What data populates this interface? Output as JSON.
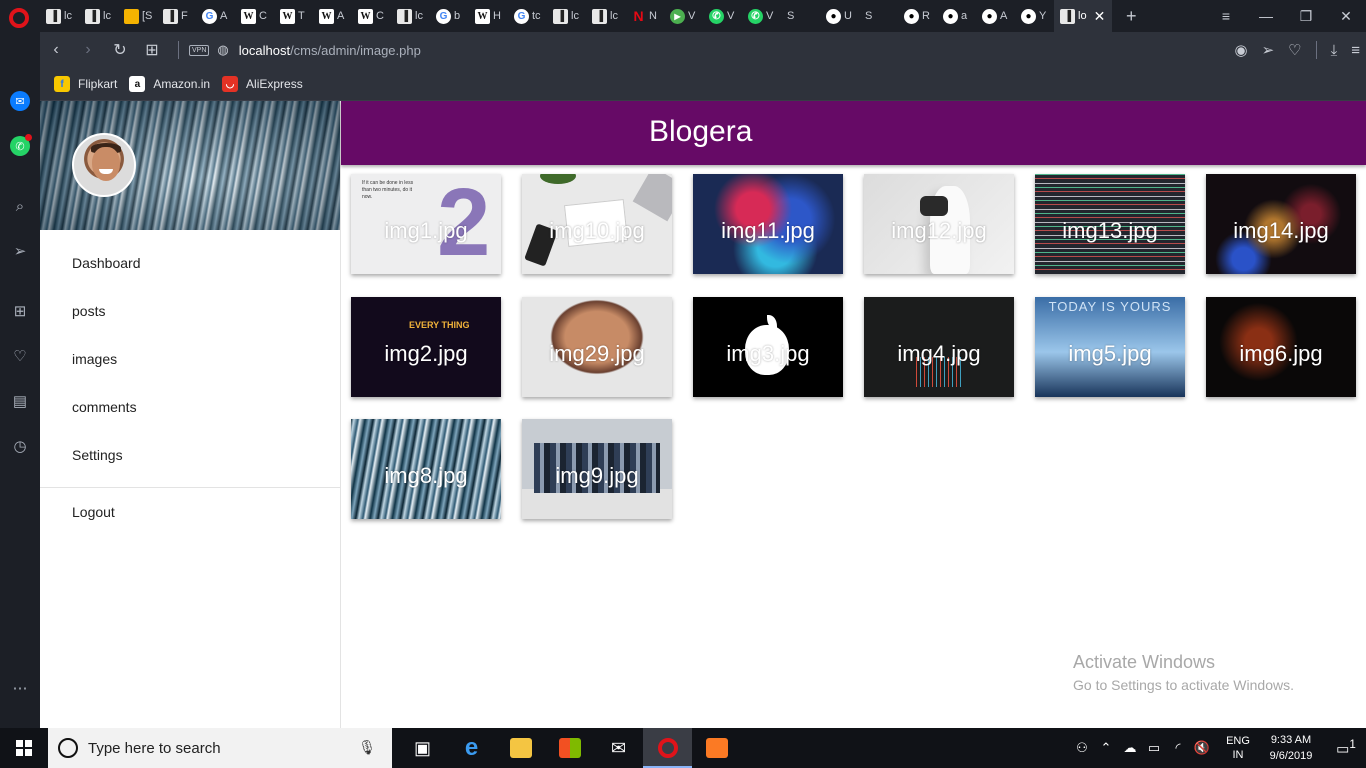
{
  "browser": {
    "tabs": [
      {
        "icon": "page-icon",
        "label": "lc",
        "icon_char": "▐",
        "kind": ""
      },
      {
        "icon": "page-icon",
        "label": "lc",
        "icon_char": "▐",
        "kind": ""
      },
      {
        "icon": "picture-icon",
        "label": "[S",
        "icon_char": "",
        "kind": "pic"
      },
      {
        "icon": "page-icon",
        "label": "F",
        "icon_char": "▐",
        "kind": ""
      },
      {
        "icon": "google-icon",
        "label": "A",
        "icon_char": "G",
        "kind": "g"
      },
      {
        "icon": "wikipedia-icon",
        "label": "C",
        "icon_char": "W",
        "kind": "w"
      },
      {
        "icon": "wikipedia-icon",
        "label": "T",
        "icon_char": "W",
        "kind": "w"
      },
      {
        "icon": "wikipedia-icon",
        "label": "A",
        "icon_char": "W",
        "kind": "w"
      },
      {
        "icon": "wikipedia-icon",
        "label": "C",
        "icon_char": "W",
        "kind": "w"
      },
      {
        "icon": "page-icon",
        "label": "lc",
        "icon_char": "▐",
        "kind": ""
      },
      {
        "icon": "google-icon",
        "label": "b",
        "icon_char": "G",
        "kind": "g"
      },
      {
        "icon": "wikipedia-icon",
        "label": "H",
        "icon_char": "W",
        "kind": "w"
      },
      {
        "icon": "google-icon",
        "label": "tc",
        "icon_char": "G",
        "kind": "g"
      },
      {
        "icon": "page-icon",
        "label": "lc",
        "icon_char": "▐",
        "kind": ""
      },
      {
        "icon": "page-icon",
        "label": "lc",
        "icon_char": "▐",
        "kind": ""
      },
      {
        "icon": "netflix-icon",
        "label": "N",
        "icon_char": "N",
        "kind": "nf"
      },
      {
        "icon": "play-icon",
        "label": "V",
        "icon_char": "▶",
        "kind": "play"
      },
      {
        "icon": "whatsapp-icon",
        "label": "V",
        "icon_char": "✆",
        "kind": "wa"
      },
      {
        "icon": "whatsapp-icon",
        "label": "V",
        "icon_char": "✆",
        "kind": "wa"
      },
      {
        "icon": "grid-icon",
        "label": "S",
        "icon_char": "▦",
        "kind": "grid"
      },
      {
        "icon": "github-icon",
        "label": "U",
        "icon_char": "●",
        "kind": "gh"
      },
      {
        "icon": "grid-icon",
        "label": "S",
        "icon_char": "▦",
        "kind": "grid"
      },
      {
        "icon": "github-icon",
        "label": "R",
        "icon_char": "●",
        "kind": "gh"
      },
      {
        "icon": "github-icon",
        "label": "a",
        "icon_char": "●",
        "kind": "gh"
      },
      {
        "icon": "github-icon",
        "label": "A",
        "icon_char": "●",
        "kind": "gh"
      },
      {
        "icon": "github-icon",
        "label": "Y",
        "icon_char": "●",
        "kind": "gh"
      }
    ],
    "active_tab": {
      "label": "lo",
      "icon": "page-icon"
    },
    "url_host": "localhost",
    "url_path": "/cms/admin/image.php",
    "bookmarks": [
      {
        "label": "Flipkart",
        "icon": "flipkart-icon",
        "icon_char": "f",
        "color": "#f8c800",
        "fg": "#2874f0"
      },
      {
        "label": "Amazon.in",
        "icon": "amazon-icon",
        "icon_char": "a",
        "color": "#ffffff",
        "fg": "#111111"
      },
      {
        "label": "AliExpress",
        "icon": "aliexpress-icon",
        "icon_char": "◡",
        "color": "#e43225",
        "fg": "#ffffff"
      }
    ]
  },
  "site": {
    "brand": "Blogera",
    "header_color": "#660a66",
    "menu": [
      "Dashboard",
      "posts",
      "images",
      "comments",
      "Settings"
    ],
    "logout": "Logout",
    "images": [
      {
        "caption": "img1.jpg",
        "thumb": "t1"
      },
      {
        "caption": "img10.jpg",
        "thumb": "t10"
      },
      {
        "caption": "img11.jpg",
        "thumb": "t11"
      },
      {
        "caption": "img12.jpg",
        "thumb": "t12"
      },
      {
        "caption": "img13.jpg",
        "thumb": "t13"
      },
      {
        "caption": "img14.jpg",
        "thumb": "t14"
      },
      {
        "caption": "img2.jpg",
        "thumb": "t2"
      },
      {
        "caption": "img29.jpg",
        "thumb": "t29"
      },
      {
        "caption": "img3.jpg",
        "thumb": "tapple"
      },
      {
        "caption": "img4.jpg",
        "thumb": "t4"
      },
      {
        "caption": "img5.jpg",
        "thumb": "t5"
      },
      {
        "caption": "img6.jpg",
        "thumb": "t6"
      },
      {
        "caption": "img8.jpg",
        "thumb": "t8"
      },
      {
        "caption": "img9.jpg",
        "thumb": "t9"
      }
    ],
    "thumb_texts": {
      "img1_quote": "If it can be done in less than two minutes, do it now.",
      "img1_digit": "2",
      "img2_text": "EVERY THING",
      "img5_text": "TODAY IS YOURS"
    }
  },
  "watermark": {
    "title": "Activate Windows",
    "subtitle": "Go to Settings to activate Windows."
  },
  "taskbar": {
    "search_placeholder": "Type here to search",
    "language_top": "ENG",
    "language_bottom": "IN",
    "time": "9:33 AM",
    "date": "9/6/2019",
    "notification_count": "1"
  }
}
